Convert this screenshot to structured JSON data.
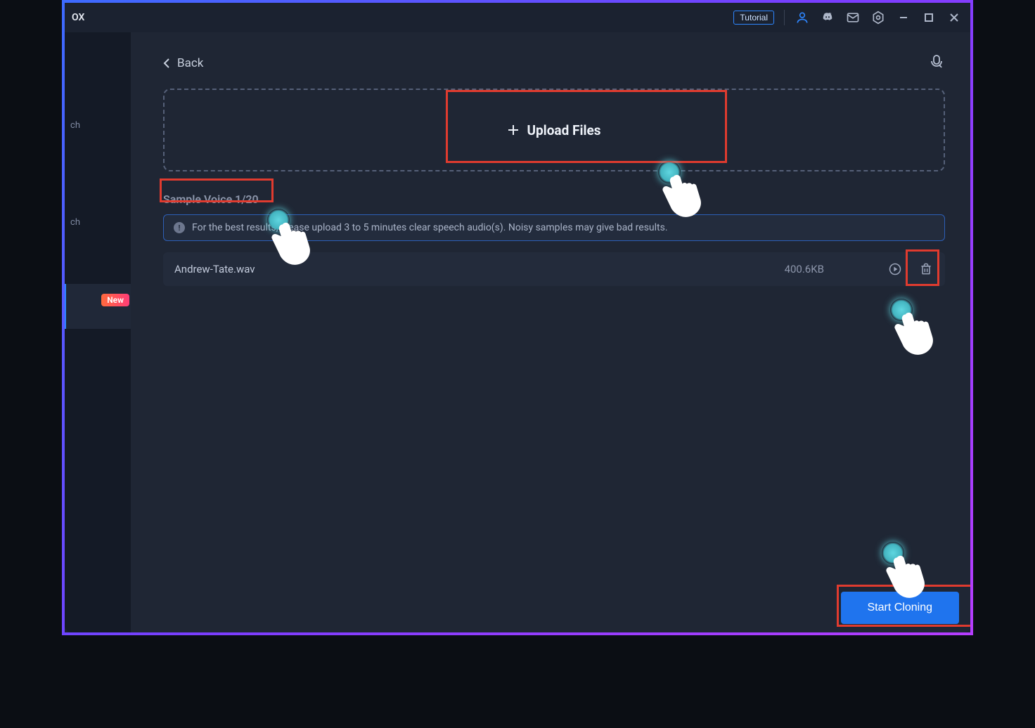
{
  "titlebar": {
    "title_fragment": "OX",
    "tutorial_label": "Tutorial"
  },
  "sidebar": {
    "frag_a": "ch",
    "frag_b": "ch",
    "new_badge": "New"
  },
  "main": {
    "back_label": "Back",
    "upload_label": "Upload Files",
    "sample_label": "Sample Voice 1/20",
    "note_text": "For the best results, please upload 3 to 5 minutes clear speech audio(s). Noisy samples may give bad results.",
    "file": {
      "name": "Andrew-Tate.wav",
      "size": "400.6KB"
    },
    "start_label": "Start Cloning"
  }
}
